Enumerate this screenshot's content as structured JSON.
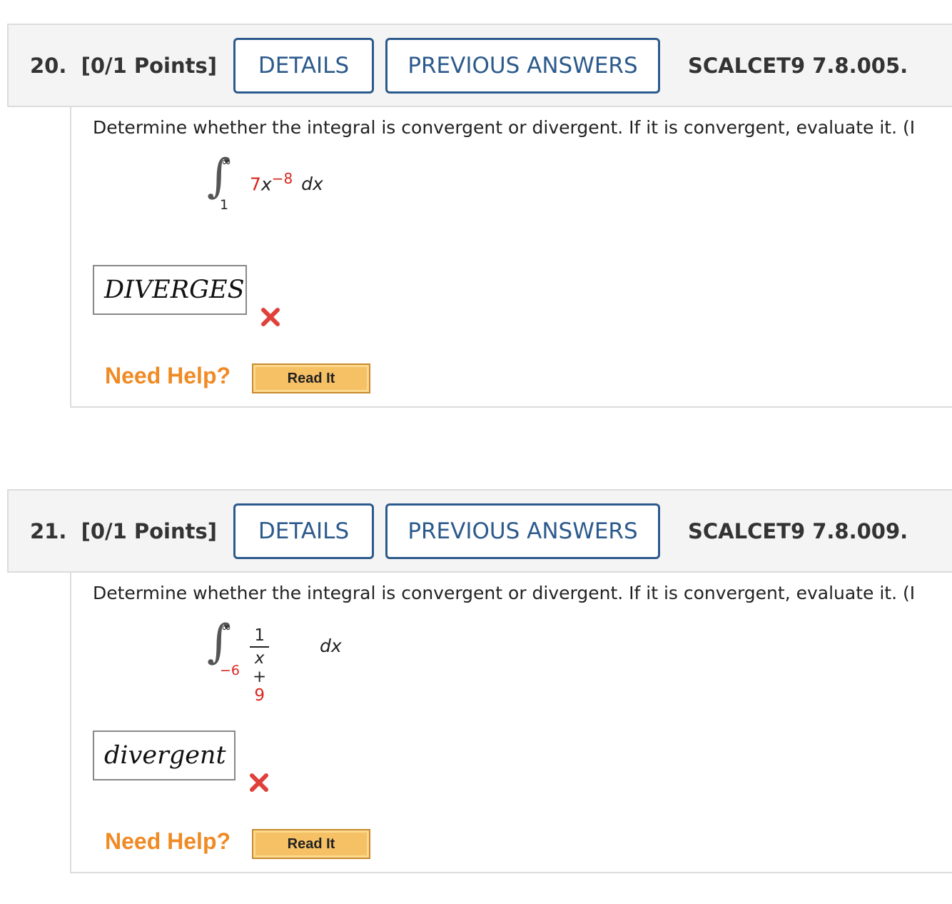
{
  "questions": [
    {
      "number": "20.",
      "points": "[0/1 Points]",
      "details_label": "DETAILS",
      "previous_answers_label": "PREVIOUS ANSWERS",
      "source": "SCALCET9 7.8.005.",
      "prompt": "Determine whether the integral is convergent or divergent. If it is convergent, evaluate it. (I",
      "integral": {
        "upper": "∞",
        "lower": "1",
        "coef": "7",
        "var": "x",
        "exponent": "−8",
        "differential": "dx"
      },
      "answer": "DIVERGES",
      "status": "incorrect",
      "need_help": "Need Help?",
      "read_it": "Read It"
    },
    {
      "number": "21.",
      "points": "[0/1 Points]",
      "details_label": "DETAILS",
      "previous_answers_label": "PREVIOUS ANSWERS",
      "source": "SCALCET9 7.8.009.",
      "prompt": "Determine whether the integral is convergent or divergent. If it is convergent, evaluate it. (I",
      "integral": {
        "upper": "∞",
        "lower": "−6",
        "numerator": "1",
        "den_var": "x + ",
        "den_const": "9",
        "differential": "dx"
      },
      "answer": "divergent",
      "status": "incorrect",
      "need_help": "Need Help?",
      "read_it": "Read It"
    }
  ],
  "colors": {
    "button_border": "#2c5a8c",
    "need_help": "#f08a24",
    "read_it_bg": "#f6c165",
    "incorrect_x": "#e0403a",
    "highlight_red": "#d8261c"
  },
  "icons": {
    "incorrect": "close-x-icon"
  }
}
